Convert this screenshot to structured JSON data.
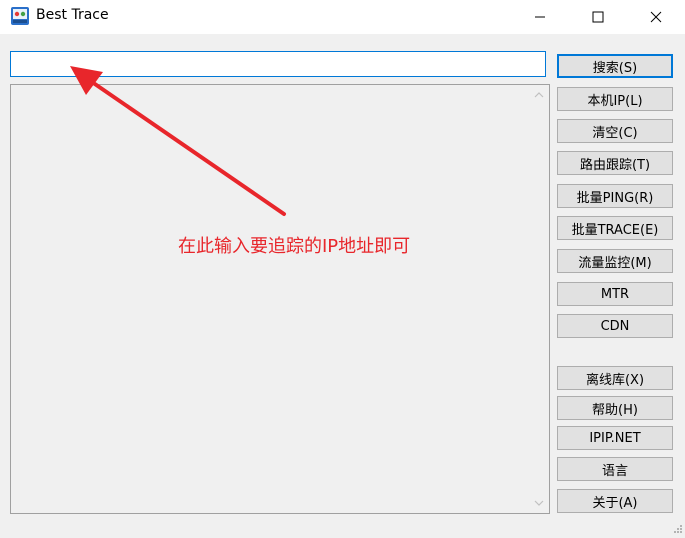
{
  "window": {
    "title": "Best Trace"
  },
  "search": {
    "value": "",
    "placeholder": ""
  },
  "buttons": [
    {
      "label": "搜索(S)"
    },
    {
      "label": "本机IP(L)"
    },
    {
      "label": "清空(C)"
    },
    {
      "label": "路由跟踪(T)"
    },
    {
      "label": "批量PING(R)"
    },
    {
      "label": "批量TRACE(E)"
    },
    {
      "label": "流量监控(M)"
    },
    {
      "label": "MTR"
    },
    {
      "label": "CDN"
    },
    {
      "label": "离线库(X)"
    },
    {
      "label": "帮助(H)"
    },
    {
      "label": "IPIP.NET"
    },
    {
      "label": "语言"
    },
    {
      "label": "关于(A)"
    }
  ],
  "annotation": {
    "text": "在此输入要追踪的IP地址即可"
  },
  "colors": {
    "accent": "#0078d7",
    "annotation": "#e8262b",
    "window_bg": "#f0f0f0",
    "button_bg": "#e1e1e1"
  },
  "icons": {
    "app": "best-trace-app-icon",
    "minimize": "minimize-icon",
    "maximize": "maximize-icon",
    "close": "close-icon"
  }
}
